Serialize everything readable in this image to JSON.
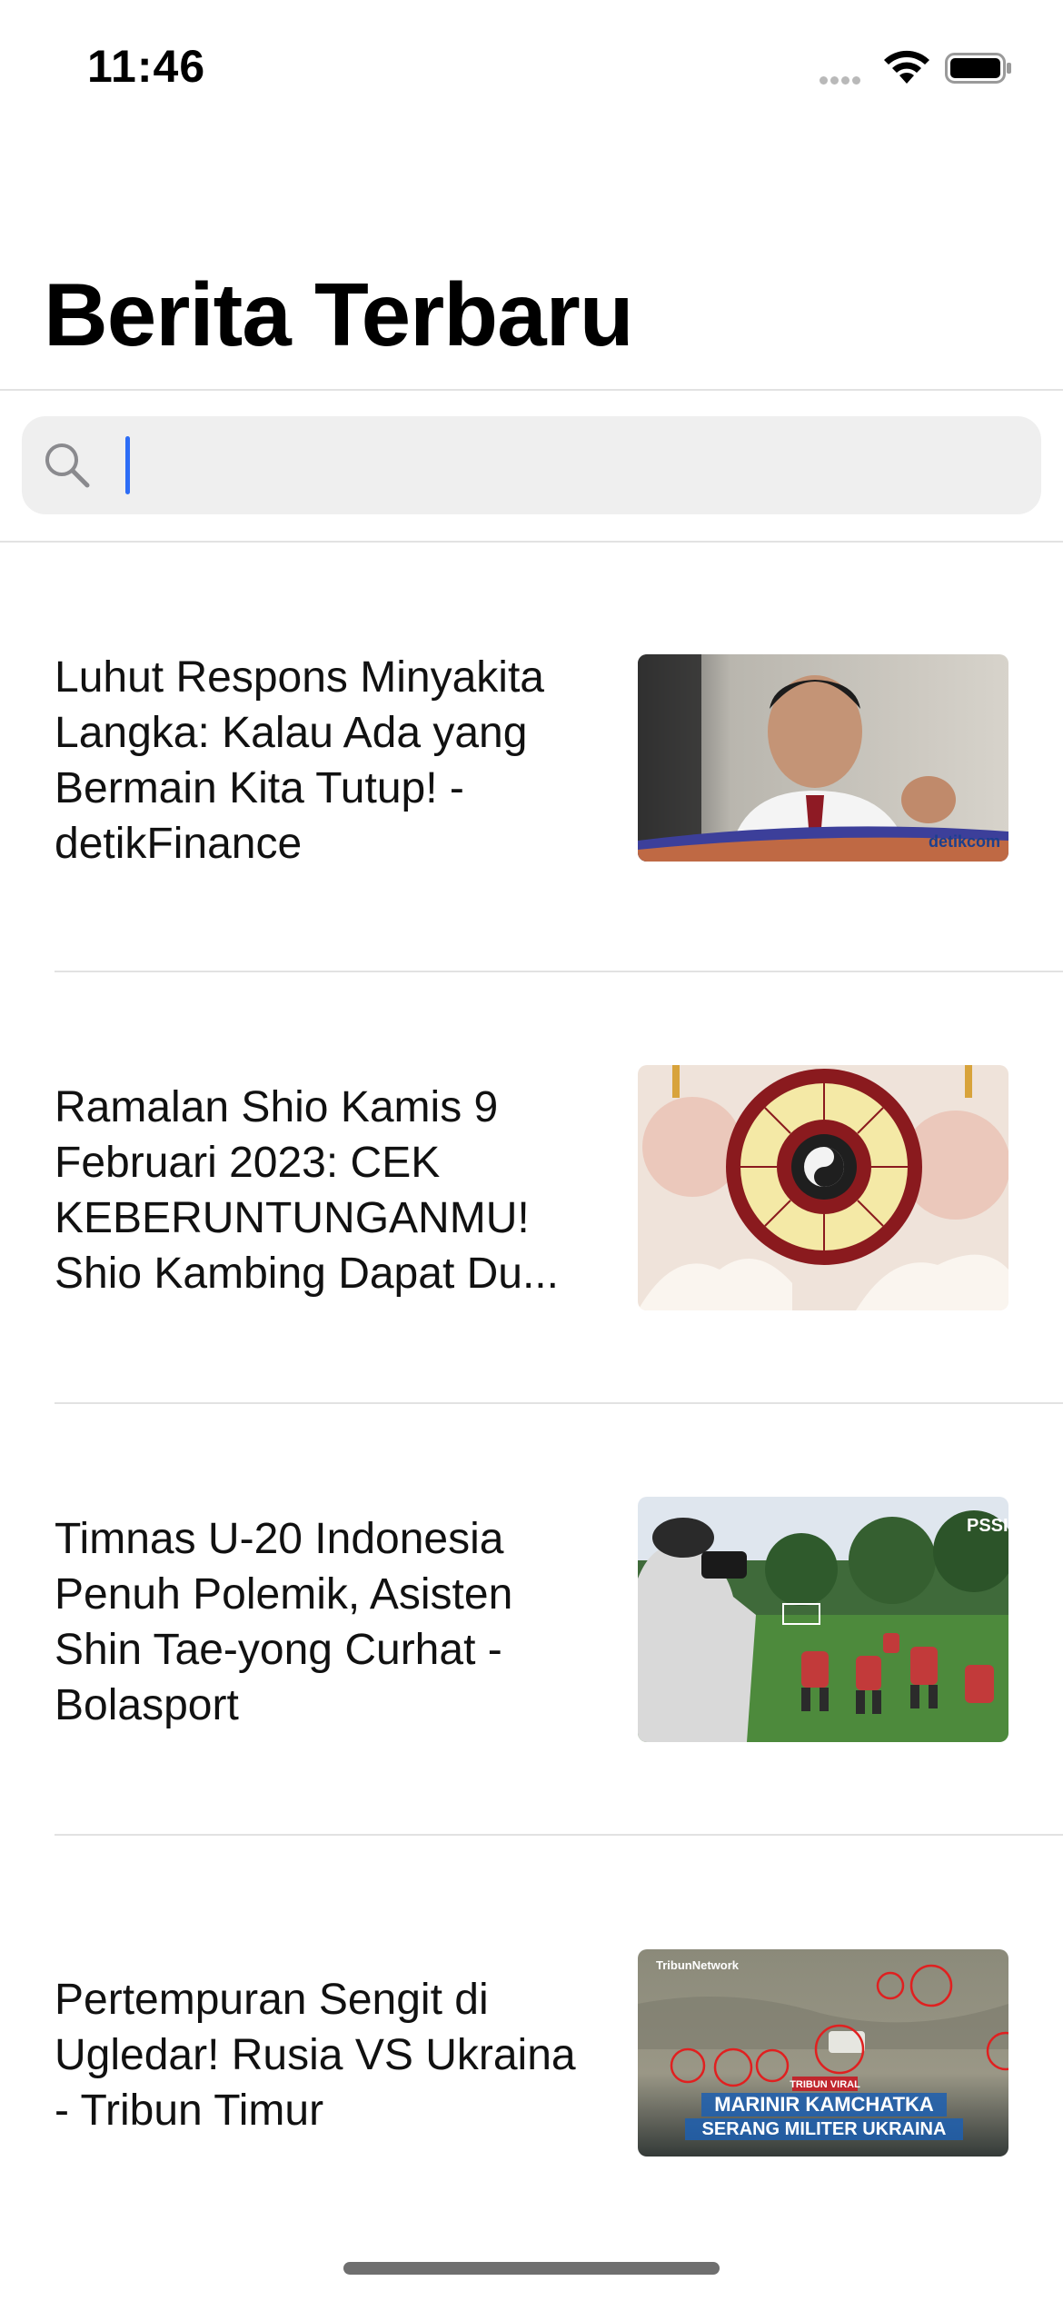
{
  "status_bar": {
    "time": "11:46"
  },
  "header": {
    "title": "Berita Terbaru"
  },
  "search": {
    "value": "",
    "placeholder": ""
  },
  "news": [
    {
      "title": "Luhut Respons Minyakita Langka: Kalau Ada yang Bermain Kita Tutup! - detikFinance",
      "thumb_watermark": "detikcom"
    },
    {
      "title": "Ramalan Shio Kamis 9 Februari 2023: CEK KEBERUNTUNGANMU! Shio Kambing Dapat Du..."
    },
    {
      "title": "Timnas U-20 Indonesia Penuh Polemik, Asisten Shin Tae-yong Curhat - Bolasport",
      "thumb_watermark": "PSSI"
    },
    {
      "title": "Pertempuran Sengit di Ugledar! Rusia VS Ukraina - Tribun Timur",
      "thumb_brand": "TribunNetwork",
      "thumb_badge": "TRIBUN VIRAL",
      "thumb_headline_1": "MARINIR KAMCHATKA",
      "thumb_headline_2": "SERANG MILITER UKRAINA"
    }
  ]
}
